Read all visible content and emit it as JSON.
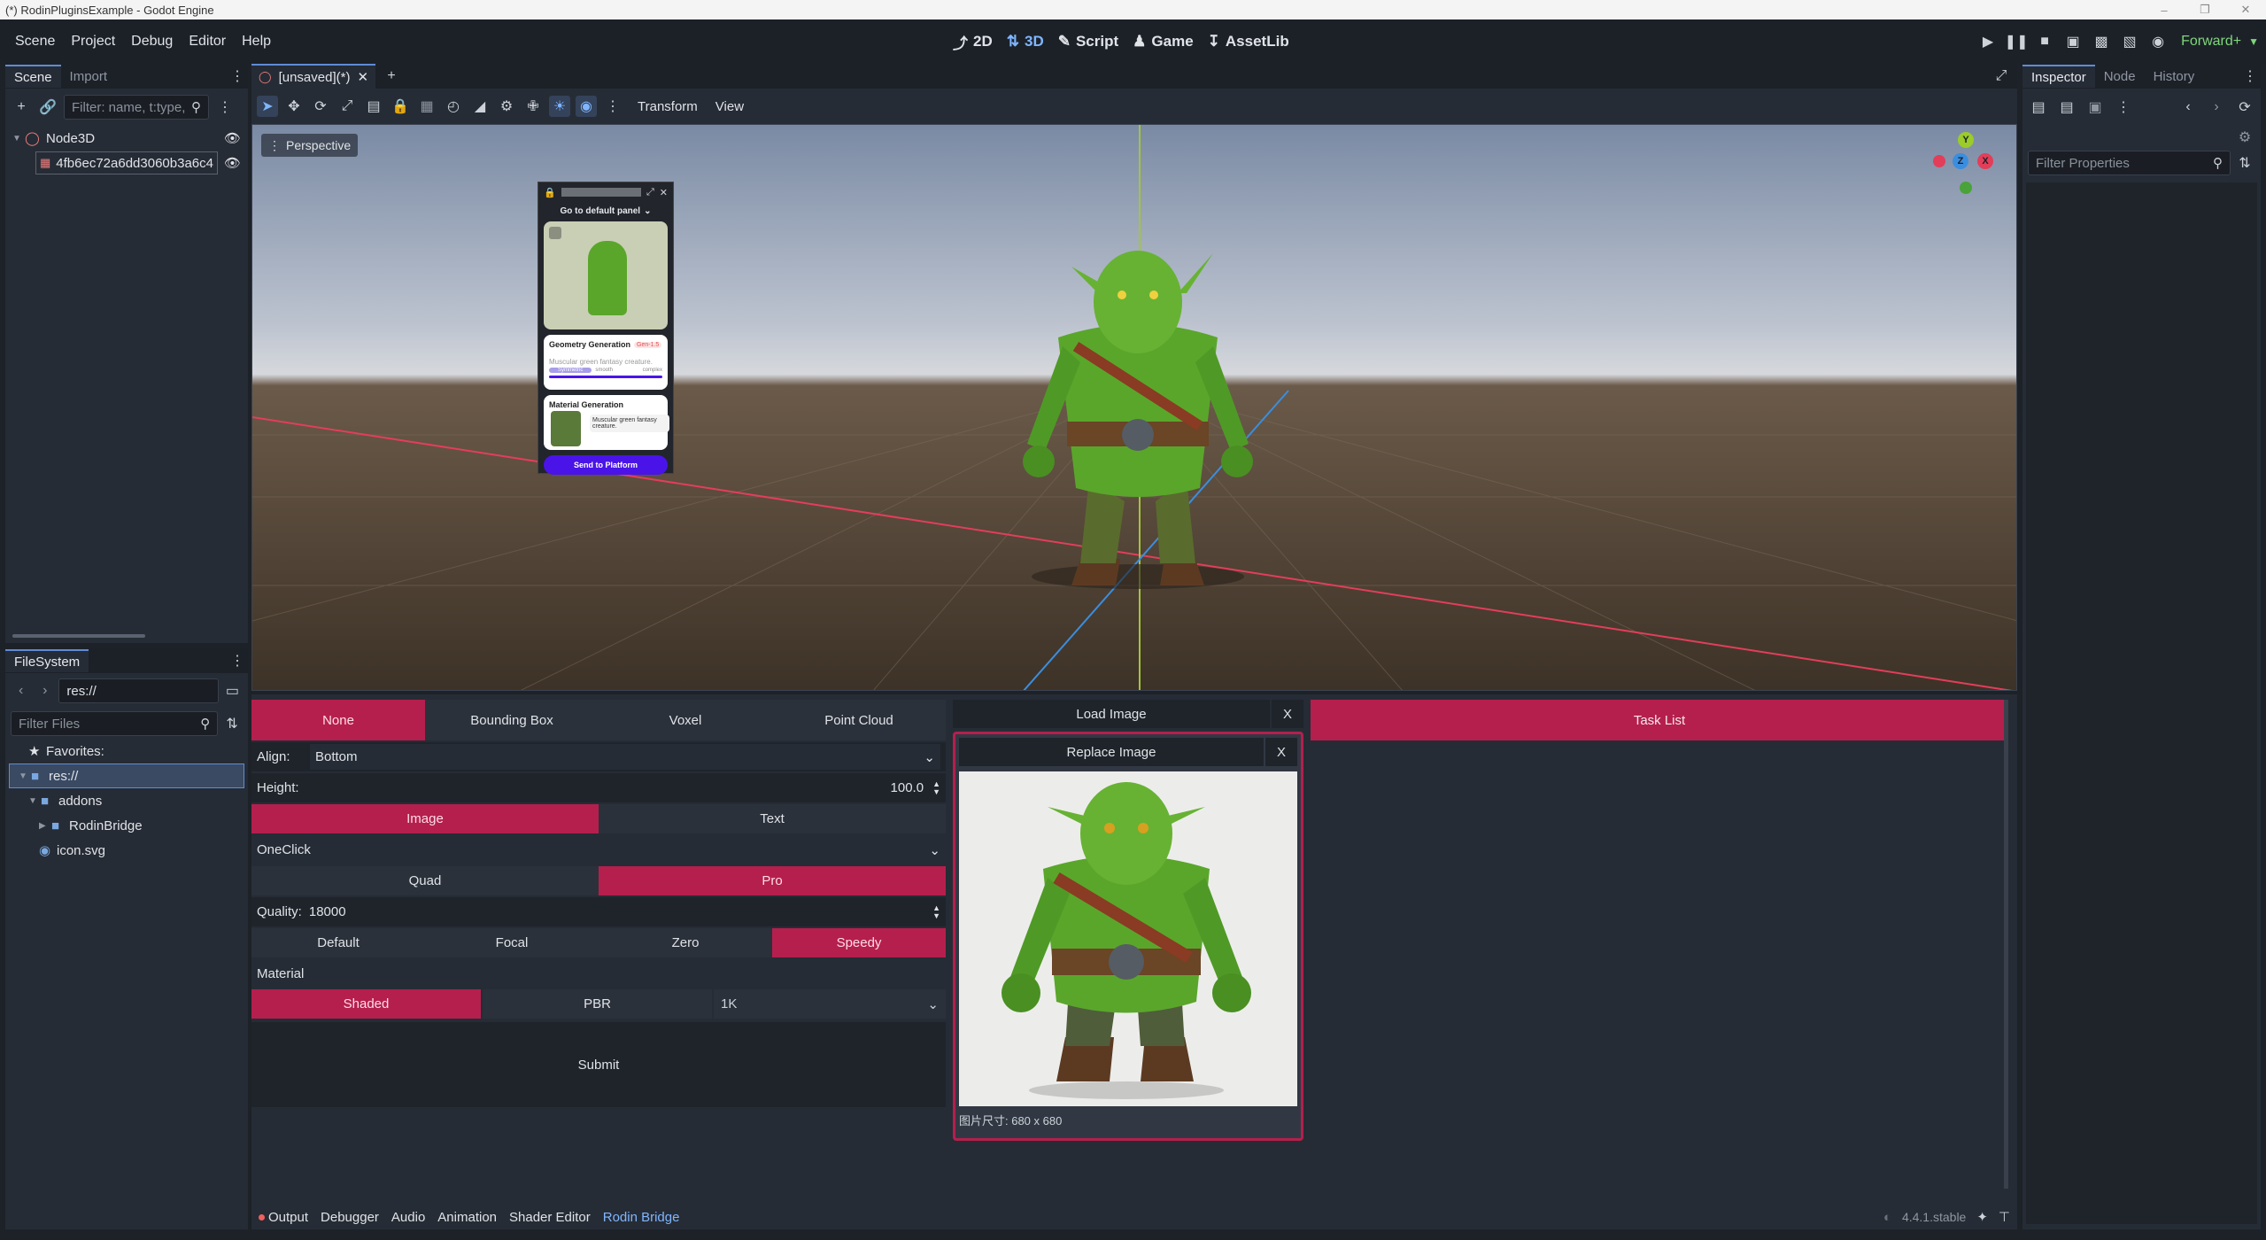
{
  "window": {
    "title": "(*) RodinPluginsExample - Godot Engine"
  },
  "menu": [
    "Scene",
    "Project",
    "Debug",
    "Editor",
    "Help"
  ],
  "modes": [
    {
      "label": "2D",
      "icon": "2d-icon",
      "active": false
    },
    {
      "label": "3D",
      "icon": "3d-icon",
      "active": true
    },
    {
      "label": "Script",
      "icon": "script-icon",
      "active": false
    },
    {
      "label": "Game",
      "icon": "game-icon",
      "active": false
    },
    {
      "label": "AssetLib",
      "icon": "assetlib-icon",
      "active": false
    }
  ],
  "renderer": "Forward+",
  "scene_dock": {
    "tabs": [
      "Scene",
      "Import"
    ],
    "filter_placeholder": "Filter: name, t:type,",
    "nodes": [
      {
        "name": "Node3D",
        "icon": "node3d-icon"
      },
      {
        "name": "4fb6ec72a6dd3060b3a6c4",
        "icon": "mesh-icon"
      }
    ]
  },
  "filesystem_dock": {
    "title": "FileSystem",
    "path": "res://",
    "filter_placeholder": "Filter Files",
    "items": [
      {
        "label": "Favorites:",
        "icon": "star-icon"
      },
      {
        "label": "res://",
        "icon": "folder-icon"
      },
      {
        "label": "addons",
        "icon": "folder-icon"
      },
      {
        "label": "RodinBridge",
        "icon": "folder-icon"
      },
      {
        "label": "icon.svg",
        "icon": "image-file-icon"
      }
    ]
  },
  "scene_tab": {
    "label": "[unsaved](*)"
  },
  "viewport_toolbar": {
    "menus": [
      "Transform",
      "View"
    ]
  },
  "viewport": {
    "perspective_label": "Perspective",
    "gizmo": {
      "y": "Y",
      "z": "Z",
      "x": "X"
    },
    "overlay_panel": {
      "title": "Go to default panel",
      "geometry_title": "Geometry Generation",
      "geometry_badge": "Gen-1.5",
      "geometry_prompt": "Muscular green fantasy creature.",
      "options": [
        "Symmetric",
        "smooth",
        "complex"
      ],
      "material_title": "Material Generation",
      "material_prompt": "Muscular green fantasy creature.",
      "send_button": "Send to Platform"
    }
  },
  "rodin": {
    "modes": [
      {
        "label": "None",
        "active": true
      },
      {
        "label": "Bounding Box",
        "active": false
      },
      {
        "label": "Voxel",
        "active": false
      },
      {
        "label": "Point Cloud",
        "active": false
      }
    ],
    "align_label": "Align:",
    "align_value": "Bottom",
    "height_label": "Height:",
    "height_value": "100.0",
    "input_tabs": [
      {
        "label": "Image",
        "active": true
      },
      {
        "label": "Text",
        "active": false
      }
    ],
    "pipeline": "OneClick",
    "mesh_types": [
      {
        "label": "Quad",
        "active": false
      },
      {
        "label": "Pro",
        "active": true
      }
    ],
    "quality_label": "Quality:",
    "quality_value": "18000",
    "presets": [
      {
        "label": "Default",
        "active": false
      },
      {
        "label": "Focal",
        "active": false
      },
      {
        "label": "Zero",
        "active": false
      },
      {
        "label": "Speedy",
        "active": true
      }
    ],
    "material_label": "Material",
    "material_modes": [
      {
        "label": "Shaded",
        "active": true
      },
      {
        "label": "PBR",
        "active": false
      }
    ],
    "resolution": "1K",
    "submit": "Submit",
    "load_image": "Load Image",
    "close_label": "X",
    "replace_image": "Replace Image",
    "image_size": "图片尺寸: 680 x 680",
    "task_list": "Task List"
  },
  "bottom_tabs": [
    {
      "label": "Output",
      "active": false
    },
    {
      "label": "Debugger",
      "active": false
    },
    {
      "label": "Audio",
      "active": false
    },
    {
      "label": "Animation",
      "active": false
    },
    {
      "label": "Shader Editor",
      "active": false
    },
    {
      "label": "Rodin Bridge",
      "active": true
    }
  ],
  "version": "4.4.1.stable",
  "inspector": {
    "tabs": [
      "Inspector",
      "Node",
      "History"
    ],
    "filter_placeholder": "Filter Properties"
  },
  "colors": {
    "accent": "#b51f4d",
    "active_blue": "#7fb6ff",
    "send_button": "#4a14e8"
  }
}
